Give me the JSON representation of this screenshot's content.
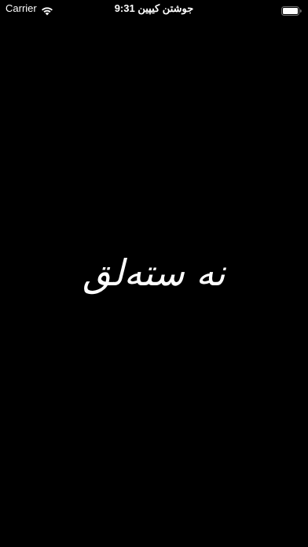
{
  "status_bar": {
    "carrier": "Carrier",
    "time": "9:31 جوشتن كيپين",
    "icons": {
      "wifi": "wifi-icon",
      "battery": "battery-icon"
    },
    "battery_level": 1.0
  },
  "main": {
    "title": "نه ستەلق"
  },
  "colors": {
    "background": "#000000",
    "foreground": "#ffffff"
  }
}
